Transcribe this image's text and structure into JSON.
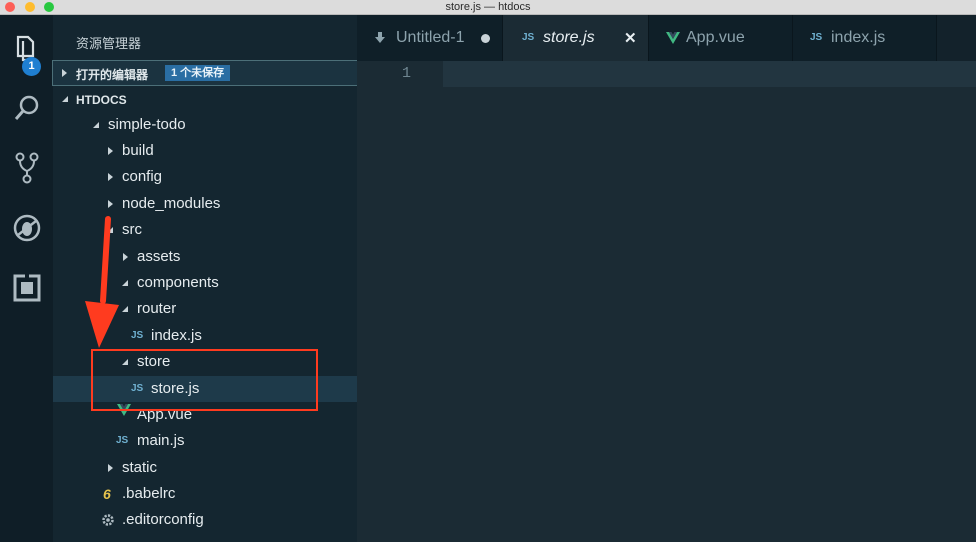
{
  "window": {
    "title": "store.js — htdocs"
  },
  "activity_bar": {
    "items": [
      {
        "icon": "files-icon",
        "badge": "1"
      },
      {
        "icon": "search-icon"
      },
      {
        "icon": "source-control-icon"
      },
      {
        "icon": "debug-icon"
      },
      {
        "icon": "extensions-icon"
      }
    ]
  },
  "sidebar": {
    "header": "资源管理器",
    "open_editors": {
      "label": "打开的编辑器",
      "badge": "1 个未保存"
    },
    "folder": {
      "label": "HTDOCS"
    },
    "tree": [
      {
        "label": "simple-todo",
        "type": "folder",
        "expanded": true
      },
      {
        "label": "build",
        "type": "folder",
        "expanded": false
      },
      {
        "label": "config",
        "type": "folder",
        "expanded": false
      },
      {
        "label": "node_modules",
        "type": "folder",
        "expanded": false
      },
      {
        "label": "src",
        "type": "folder",
        "expanded": true
      },
      {
        "label": "assets",
        "type": "folder",
        "expanded": false
      },
      {
        "label": "components",
        "type": "folder",
        "expanded": true
      },
      {
        "label": "router",
        "type": "folder",
        "expanded": true
      },
      {
        "label": "index.js",
        "type": "file",
        "icon": "JS"
      },
      {
        "label": "store",
        "type": "folder",
        "expanded": true
      },
      {
        "label": "store.js",
        "type": "file",
        "icon": "JS",
        "selected": true
      },
      {
        "label": "App.vue",
        "type": "file",
        "icon": "vue-icon"
      },
      {
        "label": "main.js",
        "type": "file",
        "icon": "JS"
      },
      {
        "label": "static",
        "type": "folder",
        "expanded": false
      },
      {
        "label": ".babelrc",
        "type": "file",
        "icon": "6"
      },
      {
        "label": ".editorconfig",
        "type": "file",
        "icon": "gear-icon"
      }
    ]
  },
  "tabs": [
    {
      "label": "Untitled-1",
      "icon": "download-icon",
      "dirty": true
    },
    {
      "label": "store.js",
      "icon": "JS",
      "active": true,
      "close": "✕"
    },
    {
      "label": "App.vue",
      "icon": "vue-icon"
    },
    {
      "label": "index.js",
      "icon": "JS"
    }
  ],
  "editor": {
    "line_number": "1"
  },
  "colors": {
    "annotation": "#ff3b1f",
    "accent": "#1f7fd1"
  }
}
